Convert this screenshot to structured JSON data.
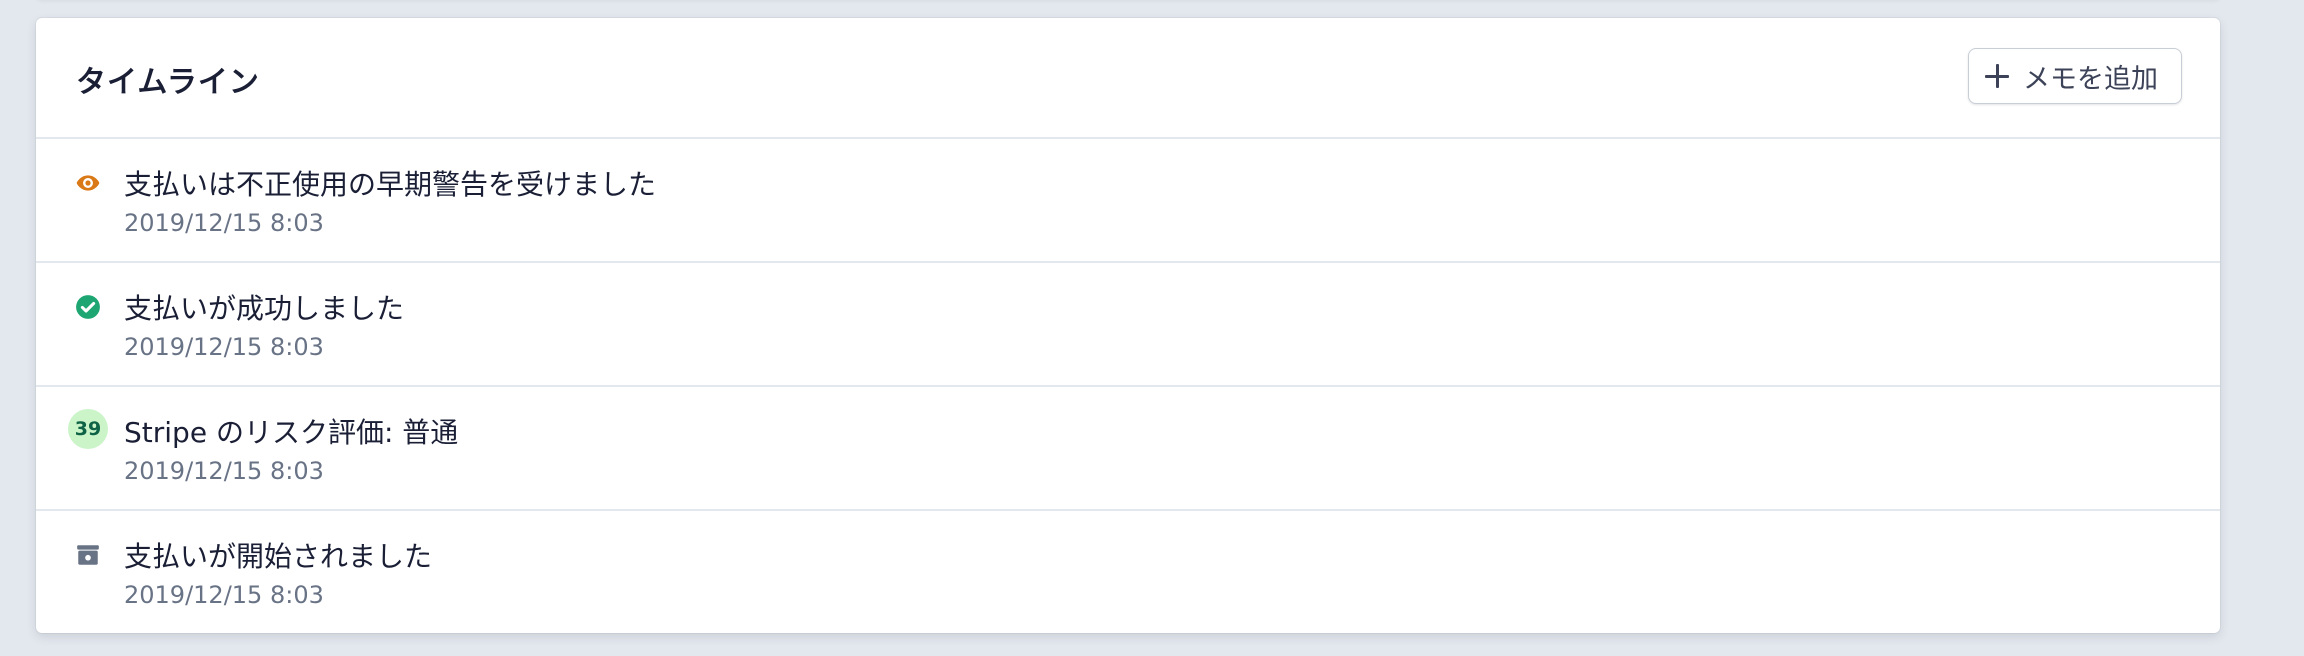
{
  "timeline": {
    "title": "タイムライン",
    "add_note_label": "メモを追加",
    "items": [
      {
        "title": "支払いは不正使用の早期警告を受けました",
        "time": "2019/12/15 8:03",
        "icon": "eye-icon",
        "icon_color": "#d97917"
      },
      {
        "title": "支払いが成功しました",
        "time": "2019/12/15 8:03",
        "icon": "check-circle-icon",
        "icon_color": "#1ea672"
      },
      {
        "title": "Stripe のリスク評価: 普通",
        "time": "2019/12/15 8:03",
        "icon": "risk-score-badge",
        "badge": "39",
        "icon_color": "#cbf4c9"
      },
      {
        "title": "支払いが開始されました",
        "time": "2019/12/15 8:03",
        "icon": "payment-icon",
        "icon_color": "#697386"
      }
    ]
  }
}
